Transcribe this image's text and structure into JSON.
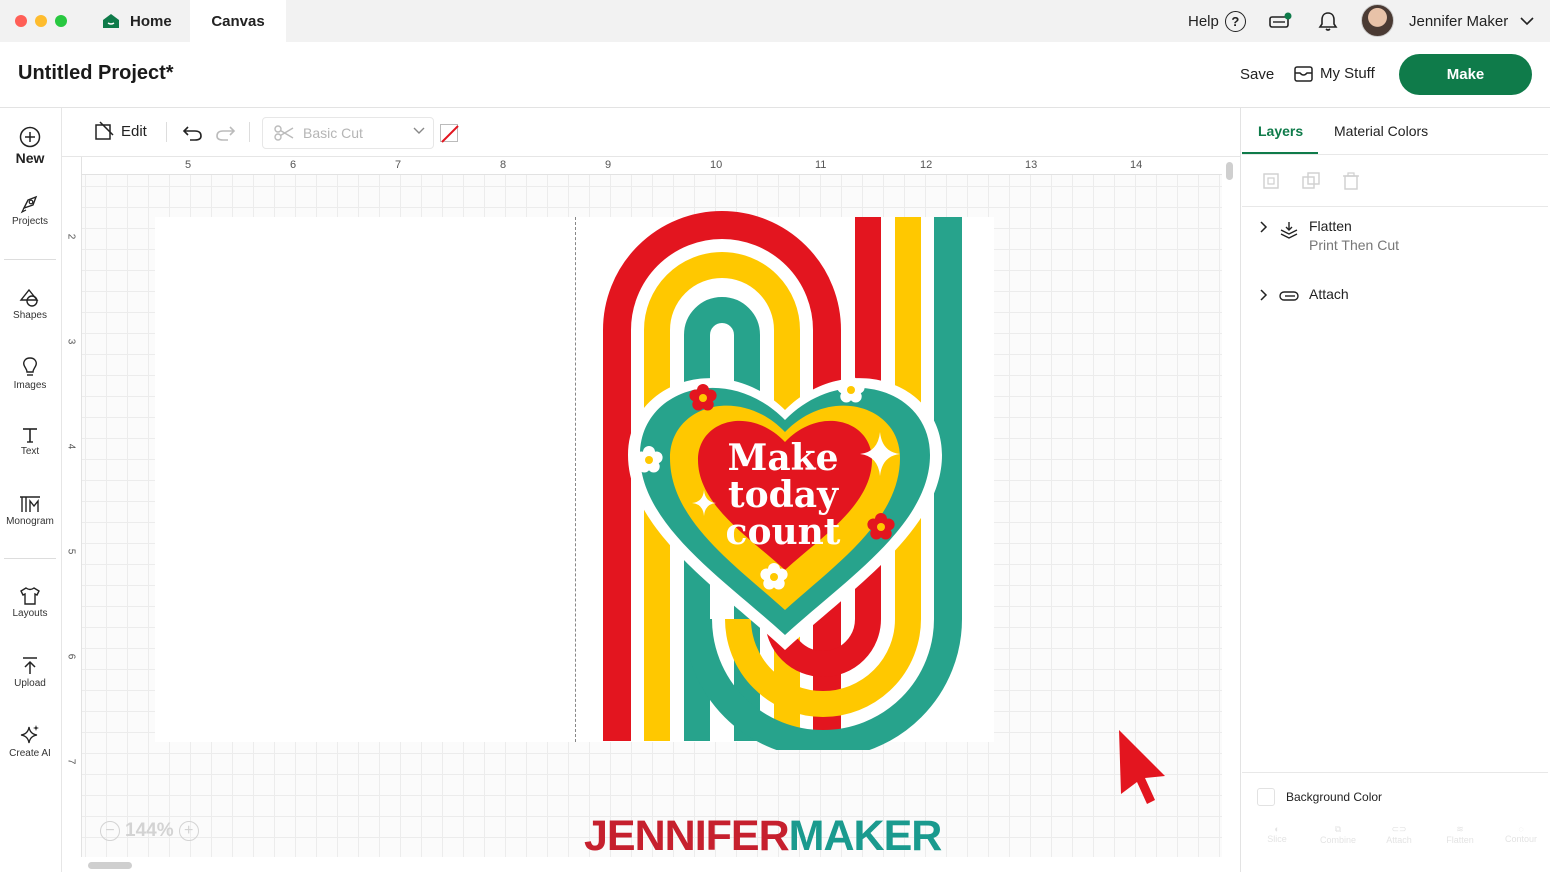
{
  "window": {
    "tabs": [
      {
        "label": "Home"
      },
      {
        "label": "Canvas"
      }
    ],
    "help_label": "Help",
    "help_icon_glyph": "?",
    "user_name": "Jennifer Maker"
  },
  "project": {
    "title": "Untitled Project*",
    "save_label": "Save",
    "mystuff_label": "My Stuff",
    "make_label": "Make"
  },
  "sidebar": {
    "items": [
      {
        "label": "New",
        "icon": "plus-circle-icon"
      },
      {
        "label": "Projects",
        "icon": "projects-icon"
      },
      {
        "label": "Shapes",
        "icon": "shapes-icon"
      },
      {
        "label": "Images",
        "icon": "images-icon"
      },
      {
        "label": "Text",
        "icon": "text-icon"
      },
      {
        "label": "Monogram",
        "icon": "monogram-icon"
      },
      {
        "label": "Layouts",
        "icon": "layouts-icon"
      },
      {
        "label": "Upload",
        "icon": "upload-icon"
      },
      {
        "label": "Create AI",
        "icon": "create-ai-icon"
      }
    ]
  },
  "toolbar": {
    "edit_label": "Edit",
    "operation_value": "Basic Cut"
  },
  "canvas": {
    "ruler_top": [
      "5",
      "6",
      "7",
      "8",
      "9",
      "10",
      "11",
      "12",
      "13",
      "14"
    ],
    "ruler_left": [
      "2",
      "3",
      "4",
      "5",
      "6",
      "7"
    ],
    "zoom_out_glyph": "−",
    "zoom_in_glyph": "+",
    "zoom_value": "144%",
    "design_text": [
      "Make",
      "today",
      "count"
    ],
    "watermark_part1": "JENNIFER",
    "watermark_part2": "MAKER",
    "colors": {
      "red": "#e3151f",
      "yellow": "#ffc800",
      "teal": "#27a38c"
    }
  },
  "right_panel": {
    "tabs": [
      "Layers",
      "Material Colors"
    ],
    "layers": [
      {
        "title": "Flatten",
        "subtitle": "Print Then Cut"
      },
      {
        "title": "Attach",
        "subtitle": ""
      }
    ],
    "background_color_label": "Background Color",
    "bottom_tools": [
      "Slice",
      "Combine",
      "Attach",
      "Flatten",
      "Contour"
    ]
  },
  "theme": {
    "accent": "#0f7b4a"
  }
}
